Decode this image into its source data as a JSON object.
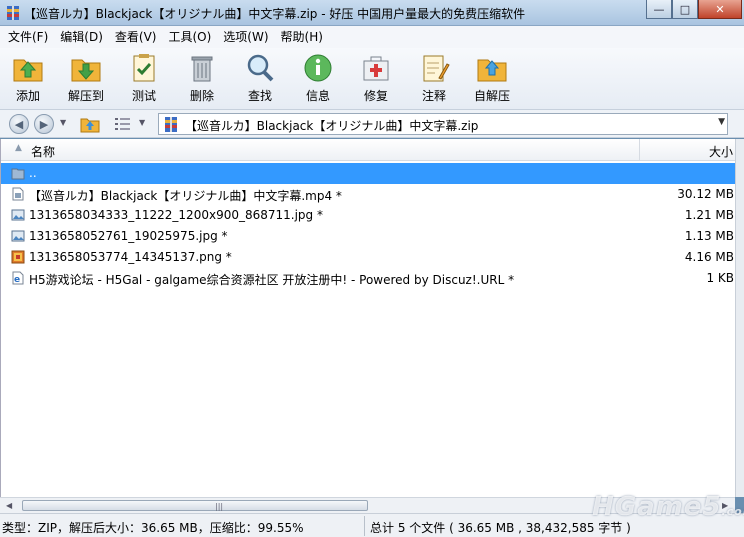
{
  "window": {
    "title": "【巡音ルカ】Blackjack【オリジナル曲】中文字幕.zip - 好压 中国用户量最大的免费压缩软件",
    "minimize": "—",
    "maximize": "□",
    "close": "✕"
  },
  "menu": [
    "文件(F)",
    "编辑(D)",
    "查看(V)",
    "工具(O)",
    "选项(W)",
    "帮助(H)"
  ],
  "toolbar": [
    {
      "label": "添加",
      "icon": "add-icon"
    },
    {
      "label": "解压到",
      "icon": "extract-icon"
    },
    {
      "label": "测试",
      "icon": "test-icon"
    },
    {
      "label": "删除",
      "icon": "delete-icon"
    },
    {
      "label": "查找",
      "icon": "find-icon"
    },
    {
      "label": "信息",
      "icon": "info-icon"
    },
    {
      "label": "修复",
      "icon": "repair-icon"
    },
    {
      "label": "注释",
      "icon": "comment-icon"
    },
    {
      "label": "自解压",
      "icon": "sfx-icon"
    }
  ],
  "address": {
    "path": "【巡音ルカ】Blackjack【オリジナル曲】中文字幕.zip"
  },
  "columns": {
    "name": "名称",
    "size": "大小"
  },
  "files": [
    {
      "name": "..",
      "size": "",
      "type": "folder-up",
      "selected": true
    },
    {
      "name": "【巡音ルカ】Blackjack【オリジナル曲】中文字幕.mp4 *",
      "size": "30.12 MB",
      "type": "video"
    },
    {
      "name": "1313658034333_11222_1200x900_868711.jpg *",
      "size": "1.21 MB",
      "type": "image"
    },
    {
      "name": "1313658052761_19025975.jpg *",
      "size": "1.13 MB",
      "type": "image"
    },
    {
      "name": "1313658053774_14345137.png *",
      "size": "4.16 MB",
      "type": "png"
    },
    {
      "name": "H5游戏论坛 - H5Gal - galgame综合资源社区 开放注册中! - Powered by Discuz!.URL *",
      "size": "1 KB",
      "type": "url"
    }
  ],
  "status": {
    "left": "类型：ZIP，解压后大小：36.65 MB，压缩比：99.55%",
    "right": "总计 5 个文件 ( 36.65 MB , 38,432,585 字节 )"
  },
  "watermark": {
    "main": "HGame5",
    "suffix": ".com"
  },
  "colors": {
    "selection": "#3399ff",
    "accent": "#f5a623"
  }
}
